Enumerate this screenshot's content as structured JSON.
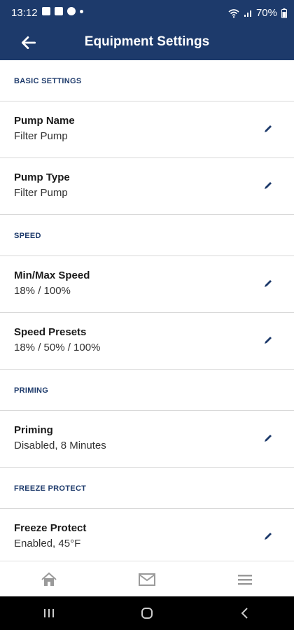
{
  "status_bar": {
    "time": "13:12",
    "battery": "70%"
  },
  "app_bar": {
    "title": "Equipment Settings"
  },
  "sections": [
    {
      "header": "BASIC SETTINGS",
      "rows": [
        {
          "label": "Pump Name",
          "value": "Filter Pump"
        },
        {
          "label": "Pump Type",
          "value": "Filter Pump"
        }
      ]
    },
    {
      "header": "SPEED",
      "rows": [
        {
          "label": "Min/Max Speed",
          "value": "18% / 100%"
        },
        {
          "label": "Speed Presets",
          "value": "18% / 50% / 100%"
        }
      ]
    },
    {
      "header": "PRIMING",
      "rows": [
        {
          "label": "Priming",
          "value": "Disabled, 8 Minutes"
        }
      ]
    },
    {
      "header": "FREEZE PROTECT",
      "rows": [
        {
          "label": "Freeze Protect",
          "value": "Enabled, 45°F"
        }
      ]
    }
  ],
  "bottom_nav": [
    "home-icon",
    "mail-icon",
    "menu-icon"
  ],
  "colors": {
    "primary": "#1d3a6b",
    "divider": "#d9d9d9"
  }
}
